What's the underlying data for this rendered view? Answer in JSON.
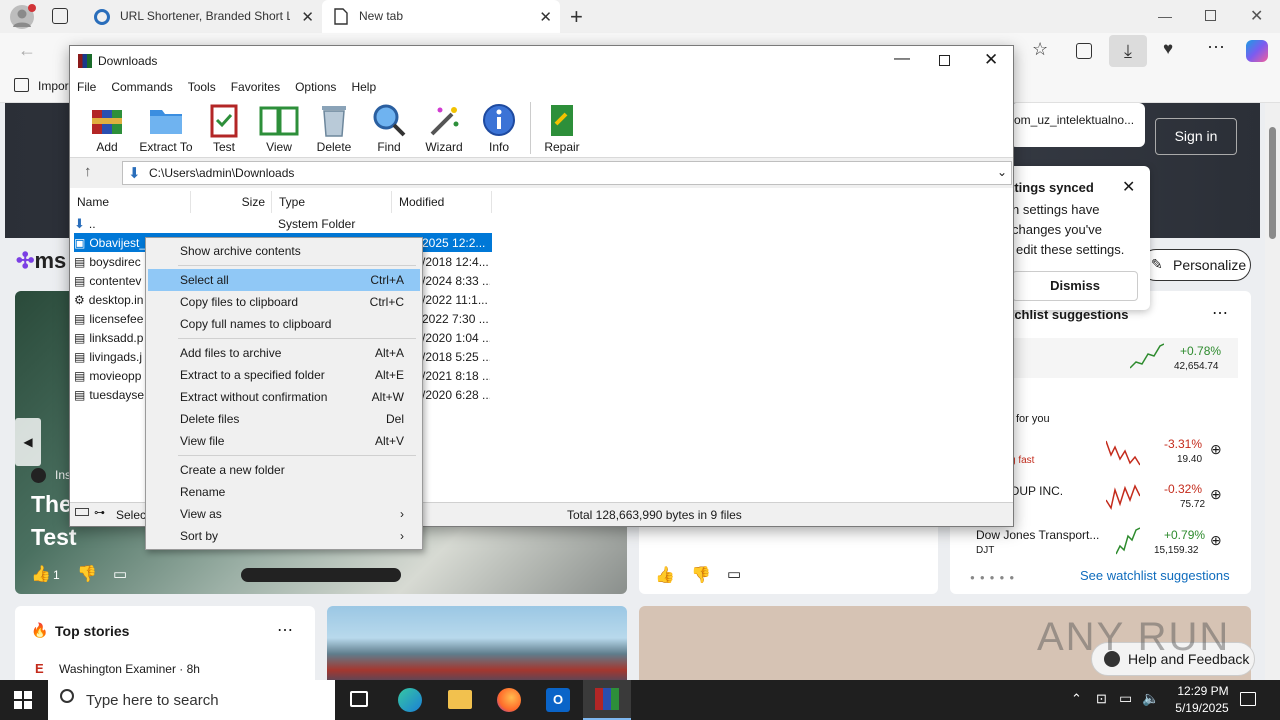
{
  "browser": {
    "tabs": [
      {
        "title": "URL Shortener, Branded Short Lin"
      },
      {
        "title": "New tab"
      }
    ],
    "favorites_bar": {
      "import_label": "Impor"
    }
  },
  "msn": {
    "logo_text": "ms",
    "sign_in": "Sign in",
    "address_snippet": "om_uz_intelektualno...",
    "sync_popup": {
      "title": "ttings synced",
      "body_lines": [
        "n settings have",
        "changes you've",
        "edit these settings."
      ],
      "dismiss": "Dismiss"
    },
    "personalize": "Personalize",
    "hero": {
      "source": "Ins",
      "title_line1": "The",
      "title_line2": "Test",
      "likes": "1"
    },
    "watchlist": {
      "title": "tchlist suggestions",
      "top_change": "+0.78%",
      "top_value": "42,654.74",
      "for_you": "for you",
      "items": [
        {
          "name": "",
          "sub": "g fast",
          "change": "-3.31%",
          "value": "19.40"
        },
        {
          "name": "OUP INC.",
          "sub": "",
          "change": "-0.32%",
          "value": "75.72"
        },
        {
          "name": "Dow Jones Transport...",
          "sub": "DJT",
          "change": "+0.79%",
          "value": "15,159.32"
        }
      ],
      "see_more": "See watchlist suggestions"
    },
    "top_stories": {
      "title": "Top stories",
      "source": "Washington Examiner · 8h"
    },
    "help_feedback": "Help and Feedback",
    "watermark": "ANY RUN"
  },
  "rar": {
    "window_title": "Downloads",
    "menu": [
      "File",
      "Commands",
      "Tools",
      "Favorites",
      "Options",
      "Help"
    ],
    "toolbar": [
      "Add",
      "Extract To",
      "Test",
      "View",
      "Delete",
      "Find",
      "Wizard",
      "Info",
      "Repair"
    ],
    "path": "C:\\Users\\admin\\Downloads",
    "columns": [
      "Name",
      "Size",
      "Type",
      "Modified"
    ],
    "rows": [
      {
        "name": "..",
        "type": "System Folder",
        "modified": ""
      },
      {
        "name": "Obavijest_",
        "modified": "2025 12:2..."
      },
      {
        "name": "boysdirec",
        "modified": "/2018 12:4..."
      },
      {
        "name": "contentev",
        "modified": "/2024 8:33 ..."
      },
      {
        "name": "desktop.in",
        "modified": "/2022 11:1..."
      },
      {
        "name": "licensefee",
        "modified": "2022 7:30 ..."
      },
      {
        "name": "linksadd.p",
        "modified": "/2020 1:04 ..."
      },
      {
        "name": "livingads.j",
        "modified": "/2018 5:25 ..."
      },
      {
        "name": "movieopp",
        "modified": "/2021 8:18 ..."
      },
      {
        "name": "tuesdayse",
        "modified": "/2020 6:28 ..."
      }
    ],
    "status_left": "Select",
    "status_total": "Total 128,663,990 bytes in 9 files"
  },
  "context_menu": {
    "items": [
      {
        "label": "Show archive contents",
        "shortcut": ""
      },
      {
        "label": "Select all",
        "shortcut": "Ctrl+A"
      },
      {
        "label": "Copy files to clipboard",
        "shortcut": "Ctrl+C"
      },
      {
        "label": "Copy full names to clipboard",
        "shortcut": ""
      },
      {
        "label": "Add files to archive",
        "shortcut": "Alt+A"
      },
      {
        "label": "Extract to a specified folder",
        "shortcut": "Alt+E"
      },
      {
        "label": "Extract without confirmation",
        "shortcut": "Alt+W"
      },
      {
        "label": "Delete files",
        "shortcut": "Del"
      },
      {
        "label": "View file",
        "shortcut": "Alt+V"
      },
      {
        "label": "Create a new folder",
        "shortcut": ""
      },
      {
        "label": "Rename",
        "shortcut": ""
      },
      {
        "label": "View as",
        "shortcut": ""
      },
      {
        "label": "Sort by",
        "shortcut": ""
      }
    ]
  },
  "taskbar": {
    "search_placeholder": "Type here to search",
    "time": "12:29 PM",
    "date": "5/19/2025"
  }
}
